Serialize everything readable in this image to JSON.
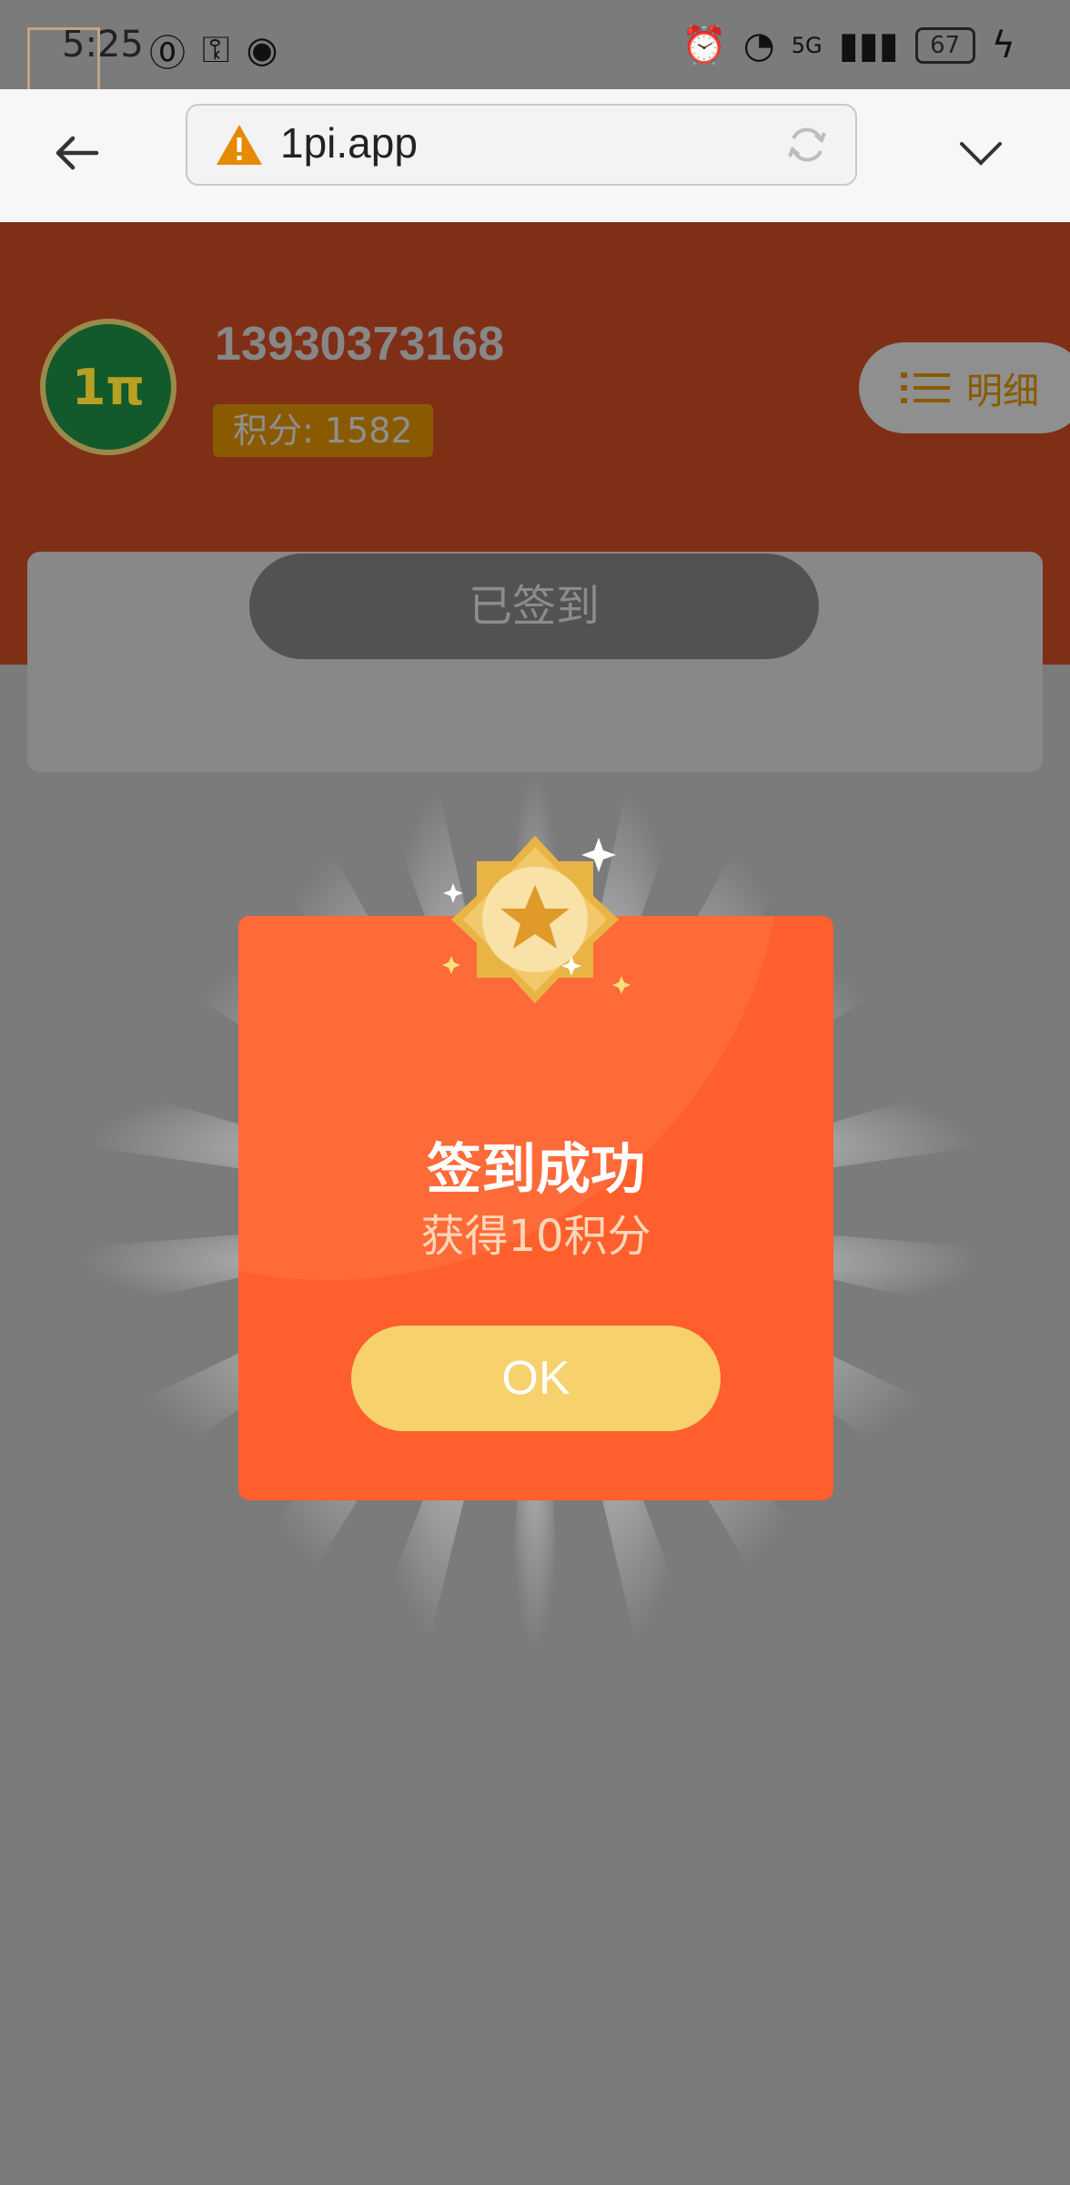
{
  "status_bar": {
    "time": "5:25",
    "network": "5G",
    "battery": "67"
  },
  "browser": {
    "url": "1pi.app"
  },
  "profile": {
    "phone": "13930373168",
    "points_label": "积分: 1582",
    "detail_label": "明细",
    "avatar_text": "1π"
  },
  "signin": {
    "status_label": "已签到"
  },
  "dialog": {
    "title": "签到成功",
    "subtitle": "获得10积分",
    "ok_label": "OK"
  },
  "colors": {
    "header_bg": "#7f2f16",
    "dialog_bg": "#ff5f2c",
    "ok_button": "#f6d16c",
    "points_badge": "#8a5a00"
  }
}
